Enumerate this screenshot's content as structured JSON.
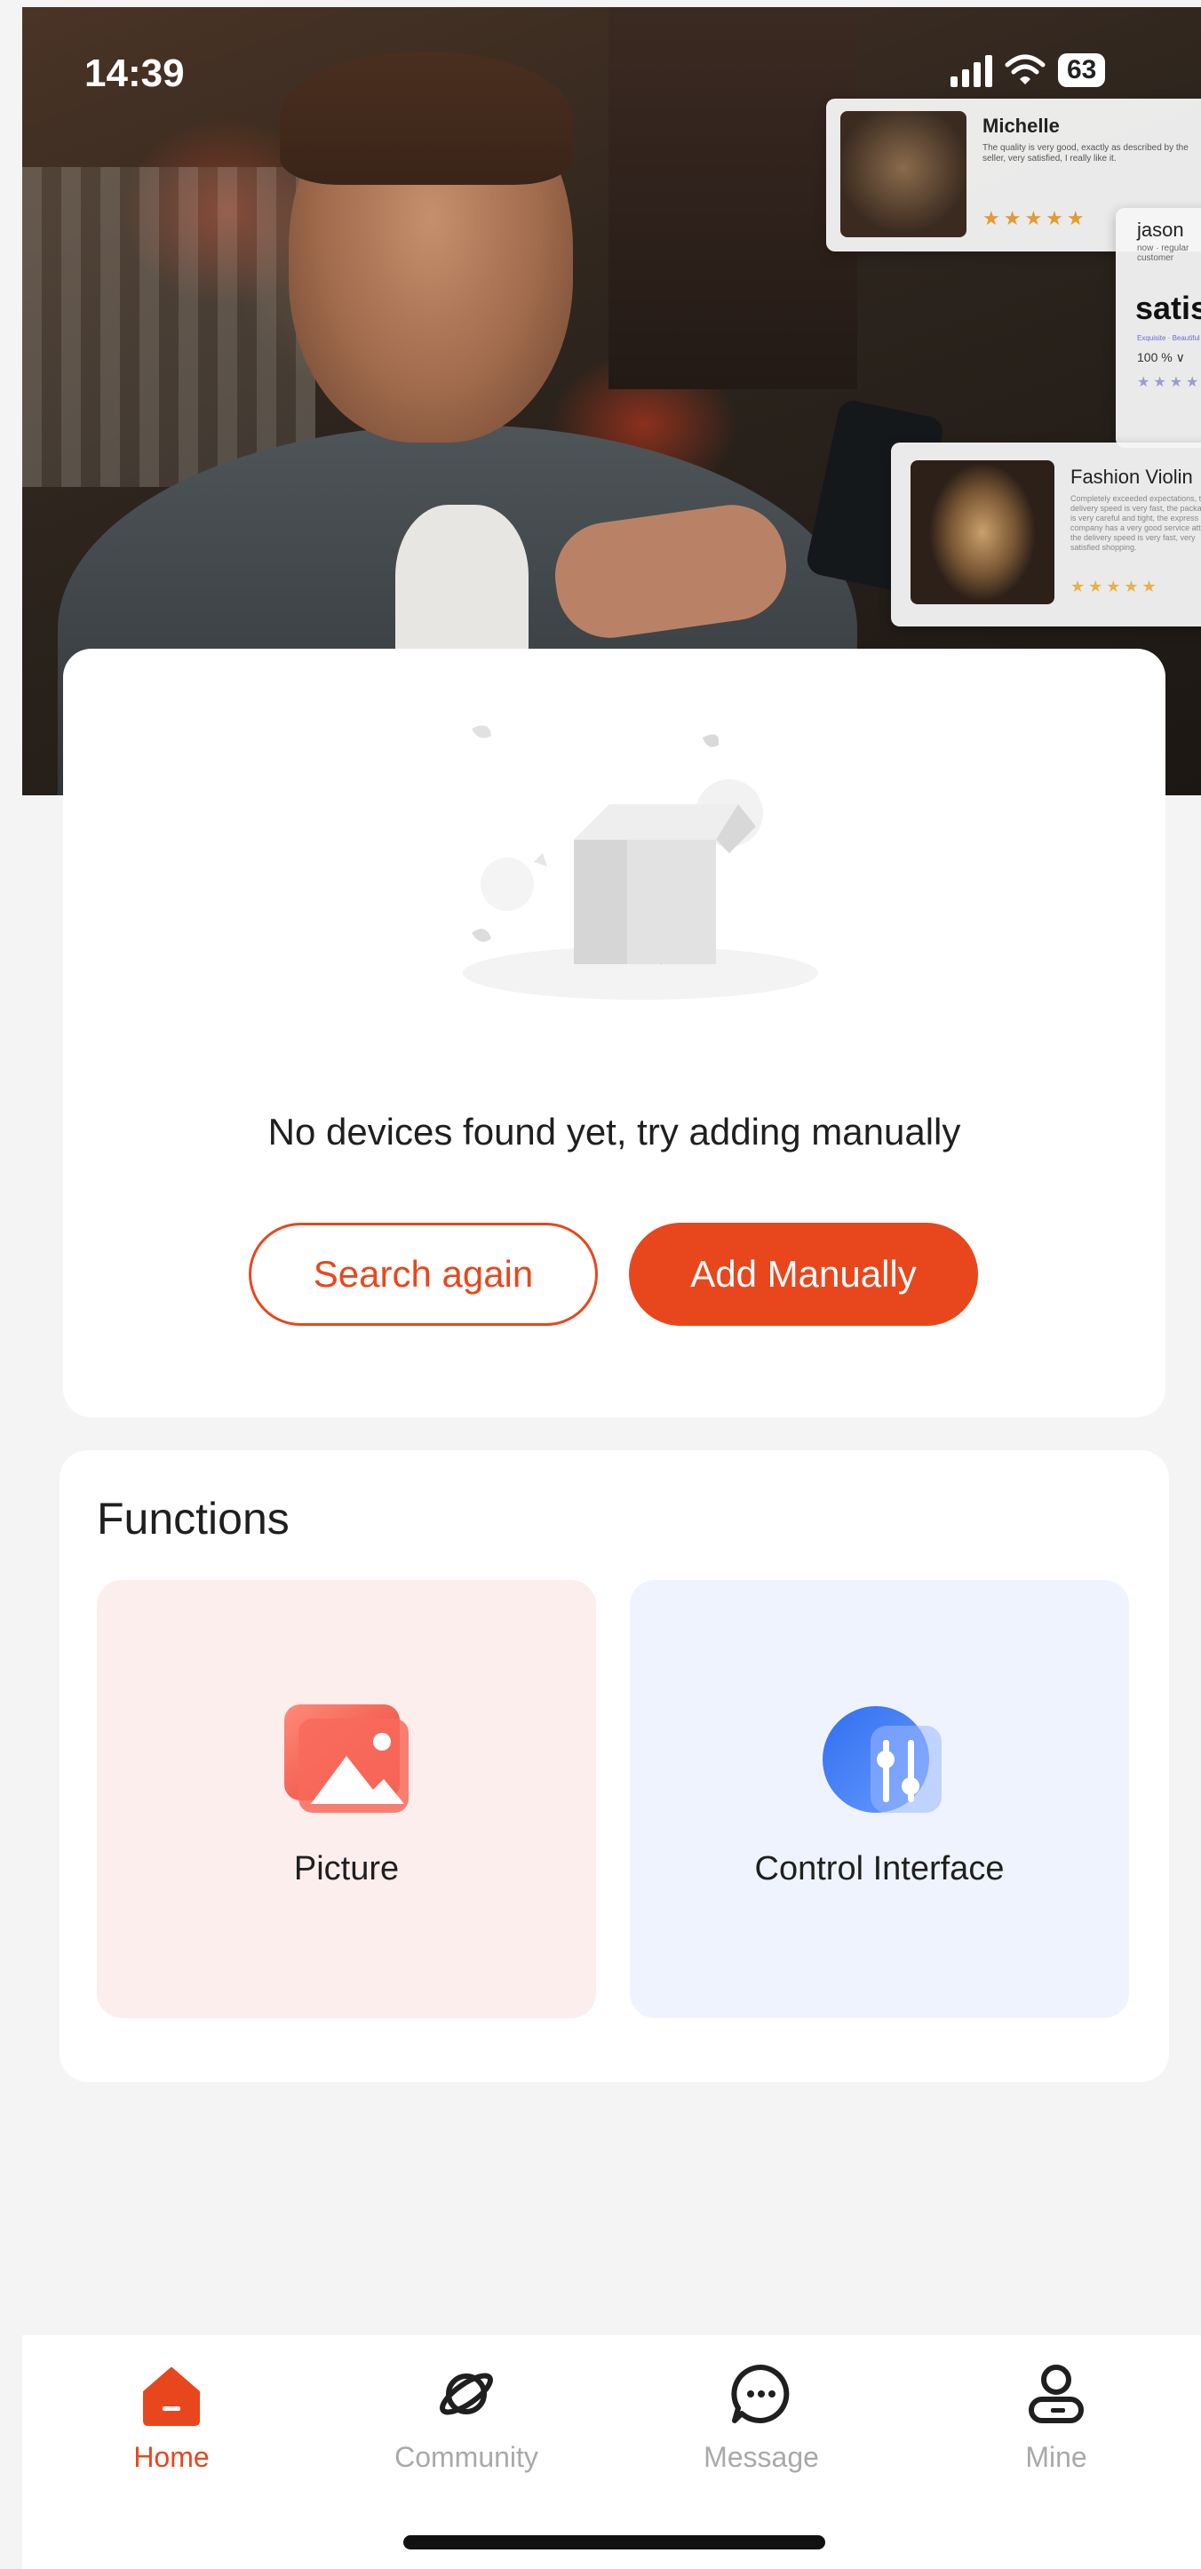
{
  "status_bar": {
    "time": "14:39",
    "battery": "63"
  },
  "hero": {
    "review1": {
      "name": "Michelle",
      "text": "The quality is very good, exactly as described by the seller, very satisfied, I really like it.",
      "stars": "★★★★★"
    },
    "review2": {
      "name": "jason",
      "sub": "now · regular customer",
      "headline": "satisf",
      "tag": "Exquisite · Beautiful",
      "percent": "100 % ∨",
      "stars": "★★★★"
    },
    "review3": {
      "name": "Fashion Violin",
      "text": "Completely exceeded expectations, the delivery speed is very fast, the packaging is very careful and tight, the express company has a very good service attitude, the delivery speed is very fast, very satisfied shopping.",
      "stars": "★★★★★"
    }
  },
  "device_empty": {
    "message": "No devices found yet, try adding manually",
    "search_again_label": "Search again",
    "add_manually_label": "Add Manually"
  },
  "functions": {
    "title": "Functions",
    "items": [
      {
        "label": "Picture",
        "icon": "picture-icon"
      },
      {
        "label": "Control Interface",
        "icon": "control-interface-icon"
      }
    ]
  },
  "bottom_nav": {
    "items": [
      {
        "label": "Home",
        "icon": "home-icon",
        "active": true
      },
      {
        "label": "Community",
        "icon": "planet-icon",
        "active": false
      },
      {
        "label": "Message",
        "icon": "chat-bubble-icon",
        "active": false
      },
      {
        "label": "Mine",
        "icon": "user-icon",
        "active": false
      }
    ]
  },
  "colors": {
    "accent": "#e8471d",
    "inactive": "#a9a9a9",
    "background": "#f4f4f4"
  }
}
